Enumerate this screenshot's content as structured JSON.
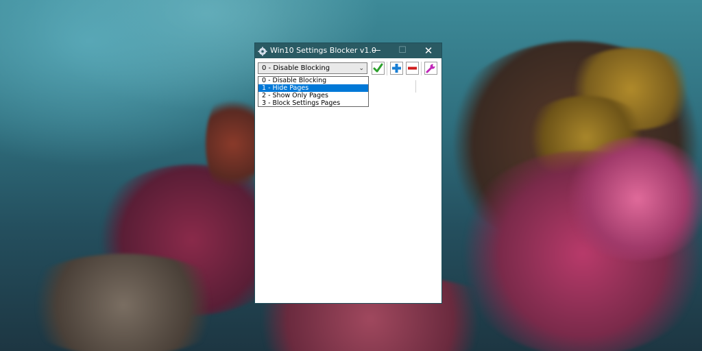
{
  "window": {
    "title": "Win10 Settings Blocker v1.0",
    "minimize_glyph": "—",
    "maximize_glyph": "☐",
    "close_glyph": "✕"
  },
  "toolbar": {
    "mode_combo": {
      "value": "0 - Disable Blocking",
      "options": [
        "0 - Disable Blocking",
        "1 - Hide Pages",
        "2 - Show Only Pages",
        "3 - Block Settings Pages"
      ],
      "highlighted_index": 1
    },
    "buttons": [
      {
        "name": "apply",
        "icon": "check-icon",
        "color": "#2ca02c"
      },
      {
        "name": "add",
        "icon": "plus-icon",
        "color": "#1a7fd4"
      },
      {
        "name": "remove",
        "icon": "minus-icon",
        "color": "#d01c1c"
      },
      {
        "name": "settings",
        "icon": "wrench-icon",
        "color": "#c026b8"
      }
    ]
  },
  "colors": {
    "titlebar": "#2a5a63",
    "selection": "#0078d7"
  }
}
